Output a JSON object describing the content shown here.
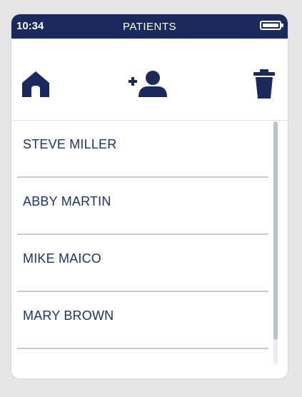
{
  "status_bar": {
    "time": "10:34",
    "title": "PATIENTS",
    "battery_icon": "battery-full-icon"
  },
  "toolbar": {
    "home_icon": "home-icon",
    "add_patient_icon": "add-user-icon",
    "delete_icon": "trash-icon"
  },
  "patients": [
    {
      "name": "STEVE MILLER"
    },
    {
      "name": "ABBY MARTIN"
    },
    {
      "name": "MIKE MAICO"
    },
    {
      "name": "MARY BROWN"
    }
  ],
  "colors": {
    "header_bg": "#1b2a5c",
    "icon": "#1b2a5c",
    "text": "#1e3366",
    "divider": "#c3ccd9"
  }
}
